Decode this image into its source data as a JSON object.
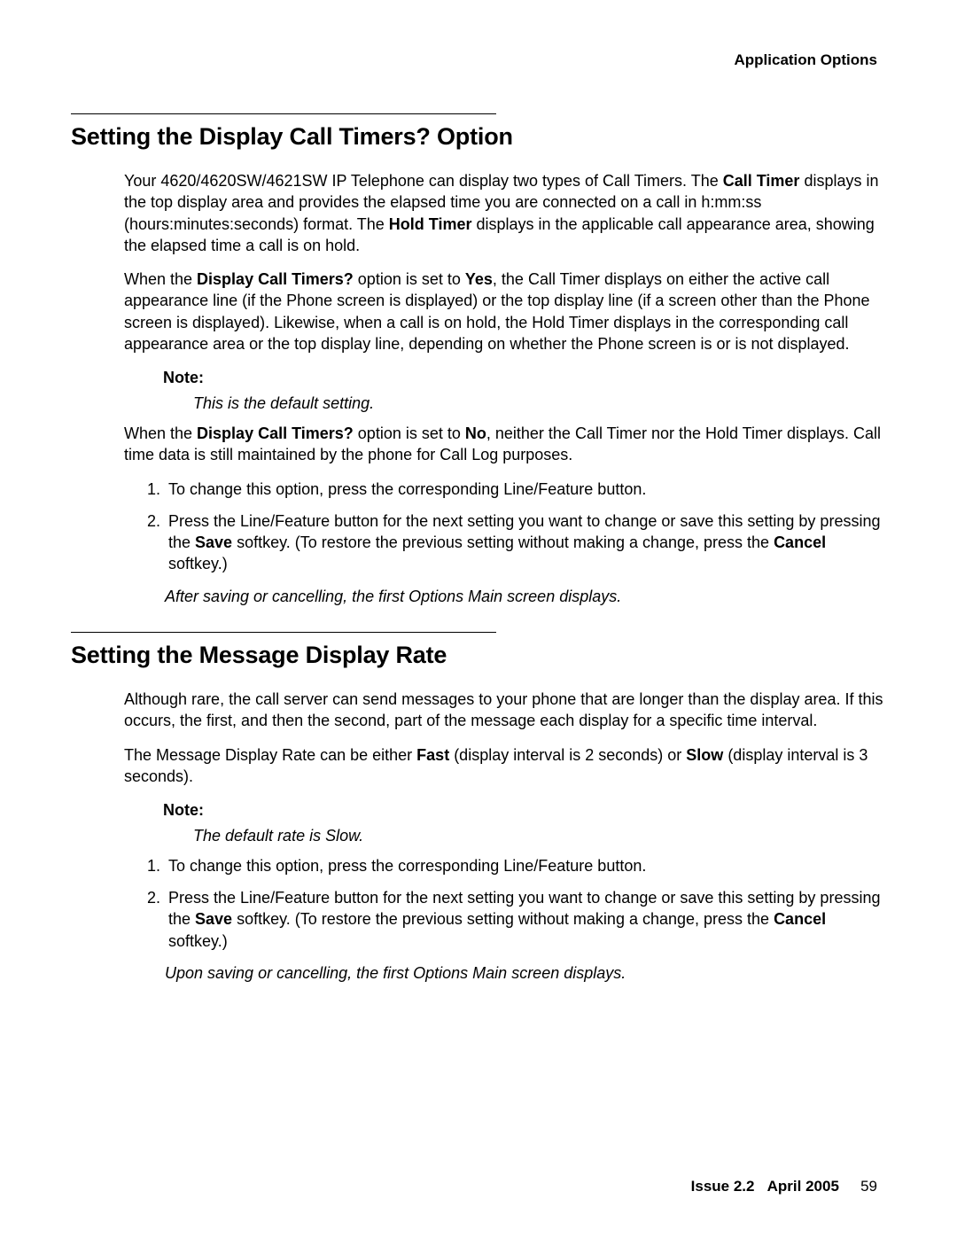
{
  "header": {
    "category": "Application Options"
  },
  "section1": {
    "heading": "Setting the Display Call Timers? Option",
    "para1_parts": {
      "t1": "Your 4620/4620SW/4621SW IP Telephone can display two types of Call Timers. The ",
      "b1": "Call Timer",
      "t2": " displays in the top display area and provides the elapsed time you are connected on a call in h:mm:ss (hours:minutes:seconds) format. The ",
      "b2": "Hold Timer",
      "t3": " displays in the applicable call appearance area, showing the elapsed time a call is on hold."
    },
    "para2_parts": {
      "t1": "When the ",
      "b1": "Display Call Timers?",
      "t2": " option is set to ",
      "b2": "Yes",
      "t3": ", the Call Timer displays on either the active call appearance line (if the Phone screen is displayed) or the top display line (if a screen other than the Phone screen is displayed). Likewise, when a call is on hold, the Hold Timer displays in the corresponding call appearance area or the top display line, depending on whether the Phone screen is or is not displayed."
    },
    "note_label": "Note:",
    "note_text": "This is the default setting.",
    "para3_parts": {
      "t1": "When the ",
      "b1": "Display Call Timers?",
      "t2": " option is set to ",
      "b2": "No",
      "t3": ", neither the Call Timer nor the Hold Timer displays. Call time data is still maintained by the phone for Call Log purposes."
    },
    "step1": "To change this option, press the corresponding Line/Feature button.",
    "step2_parts": {
      "t1": "Press the Line/Feature button for the next setting you want to change or save this setting by pressing the ",
      "b1": "Save",
      "t2": " softkey. (To restore the previous setting without making a change, press the ",
      "b2": "Cancel",
      "t3": " softkey.)"
    },
    "result": "After saving or cancelling, the first Options Main screen displays."
  },
  "section2": {
    "heading": "Setting the Message Display Rate",
    "para1": "Although rare, the call server can send messages to your phone that are longer than the display area. If this occurs, the first, and then the second, part of the message each display for a specific time interval.",
    "para2_parts": {
      "t1": "The Message Display Rate can be either ",
      "b1": "Fast",
      "t2": " (display interval is 2 seconds) or ",
      "b2": "Slow",
      "t3": " (display interval is 3 seconds)."
    },
    "note_label": "Note:",
    "note_text": "The default rate is Slow.",
    "step1": "To change this option, press the corresponding Line/Feature button.",
    "step2_parts": {
      "t1": "Press the Line/Feature button for the next setting you want to change or save this setting by pressing the ",
      "b1": "Save",
      "t2": " softkey. (To restore the previous setting without making a change, press the ",
      "b2": "Cancel",
      "t3": " softkey.)"
    },
    "result": "Upon saving or cancelling, the first Options Main screen displays."
  },
  "footer": {
    "issue": "Issue 2.2",
    "date": "April 2005",
    "page": "59"
  }
}
